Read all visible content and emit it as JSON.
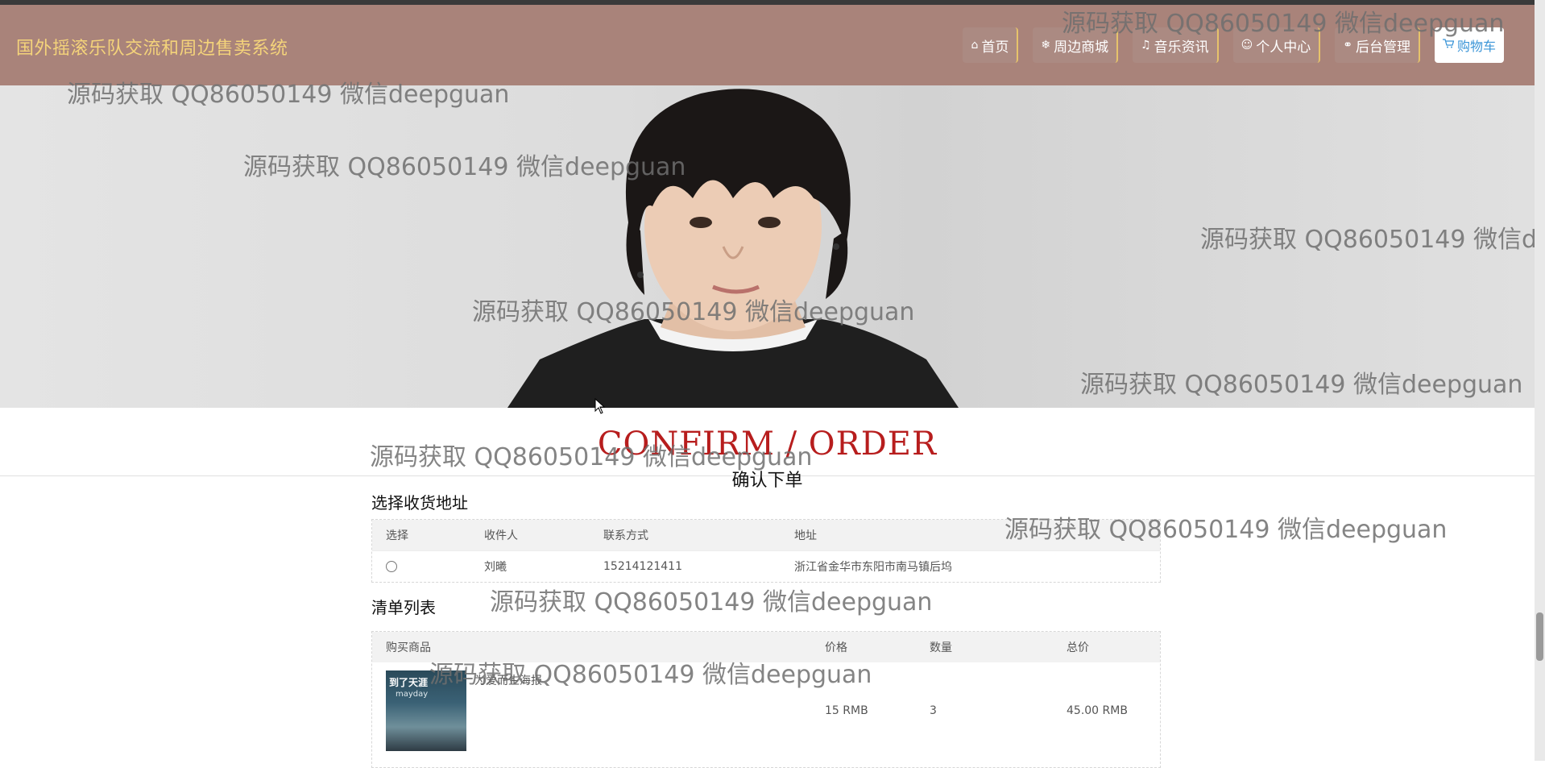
{
  "header": {
    "site_title": "国外摇滚乐队交流和周边售卖系统",
    "nav": [
      {
        "icon": "home-icon",
        "glyph": "⌂",
        "label": "首页"
      },
      {
        "icon": "snowflake-icon",
        "glyph": "❄",
        "label": "周边商城"
      },
      {
        "icon": "music-icon",
        "glyph": "♫",
        "label": "音乐资讯"
      },
      {
        "icon": "user-icon",
        "glyph": "☺",
        "label": "个人中心"
      },
      {
        "icon": "link-icon",
        "glyph": "⚭",
        "label": "后台管理"
      },
      {
        "icon": "cart-icon",
        "glyph": "🛒",
        "label": "购物车"
      }
    ]
  },
  "confirm": {
    "title": "CONFIRM / ORDER",
    "subtitle": "确认下单"
  },
  "address": {
    "label": "选择收货地址",
    "headers": [
      "选择",
      "收件人",
      "联系方式",
      "地址"
    ],
    "rows": [
      {
        "name": "刘曦",
        "phone": "15214121411",
        "address": "浙江省金华市东阳市南马镇后坞"
      }
    ]
  },
  "cart": {
    "label": "清单列表",
    "headers": [
      "购买商品",
      "价格",
      "数量",
      "总价"
    ],
    "items": [
      {
        "name": "为爱而生海报",
        "price": "15 RMB",
        "qty": "3",
        "total": "45.00 RMB",
        "thumb_text": "到了天涯",
        "thumb_sub": "mayday"
      }
    ]
  },
  "watermark": "源码获取 QQ86050149 微信deepguan",
  "colors": {
    "navbar": "#a9837a",
    "title": "#f4d37a",
    "confirm": "#b71d1d",
    "cart_text": "#3b95d7"
  }
}
